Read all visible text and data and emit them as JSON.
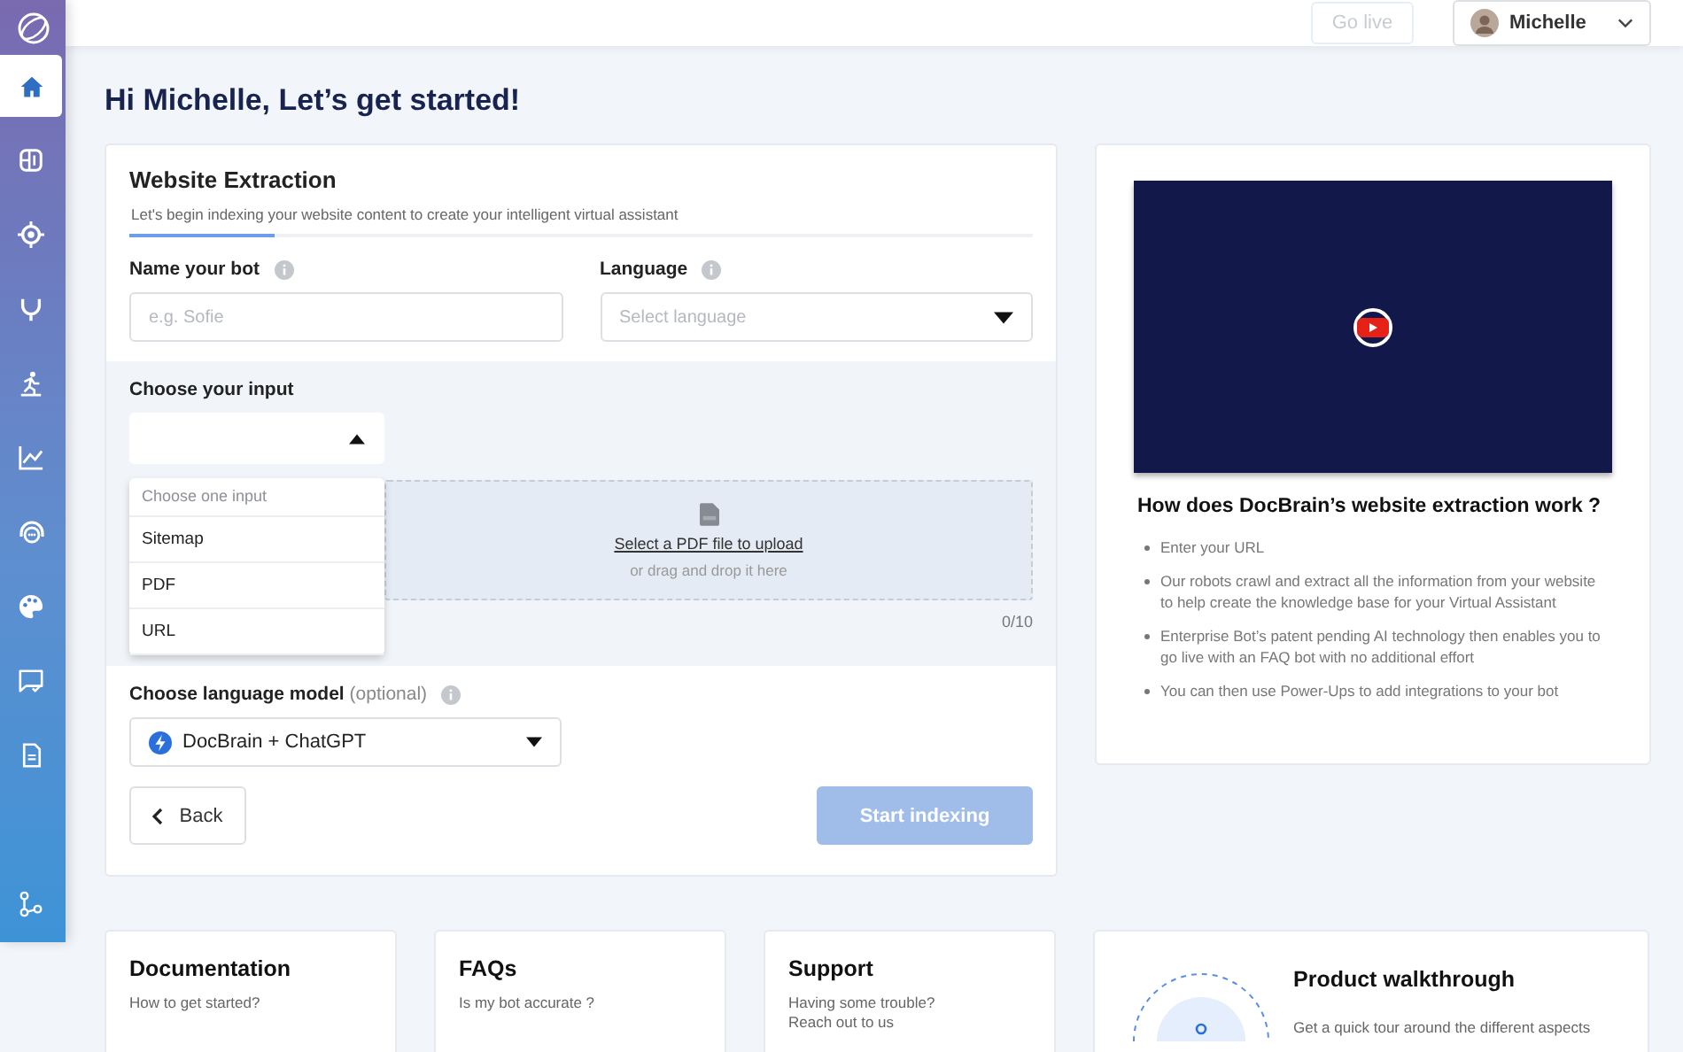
{
  "sidebar": {
    "items": [
      {
        "selected": true
      },
      {
        "selected": false
      },
      {
        "selected": false
      },
      {
        "selected": false
      },
      {
        "selected": false
      },
      {
        "selected": false
      },
      {
        "selected": false
      },
      {
        "selected": false
      },
      {
        "selected": false
      },
      {
        "selected": false
      },
      {
        "selected": false
      }
    ]
  },
  "topbar": {
    "go_live": {
      "label": "Go live",
      "disabled": true
    },
    "user": {
      "name": "Michelle"
    }
  },
  "heading": "Hi Michelle, Let’s get started!",
  "extraction": {
    "title": "Website Extraction",
    "subtitle": "Let's begin indexing your website content to create your intelligent virtual assistant",
    "progress": {
      "level": 0.16
    },
    "name_field": {
      "label": "Name your bot",
      "placeholder": "e.g. Sofie"
    },
    "language_field": {
      "label": "Language",
      "placeholder": "Select language"
    },
    "input": {
      "label": "Choose your input",
      "expanded": true,
      "menu_header": "Choose one input",
      "options": [
        "Sitemap",
        "PDF",
        "URL"
      ]
    },
    "upload": {
      "link": "Select a PDF file to upload",
      "hint": "or drag and drop it here",
      "count": "0/10"
    },
    "model": {
      "label": "Choose language model",
      "note": "(optional)",
      "value": "DocBrain + ChatGPT"
    },
    "back": "Back",
    "start": {
      "label": "Start indexing",
      "disabled": true
    }
  },
  "video_card": {
    "title": "How does DocBrain’s website extraction work ?",
    "bullets": [
      "Enter your URL",
      "Our robots crawl and extract all the information from your website to help create the knowledge base for your Virtual Assistant",
      "Enterprise Bot’s patent pending AI technology then enables you to go live with an FAQ bot with no additional effort",
      "You can then use Power-Ups to add integrations to your bot"
    ]
  },
  "resources": [
    {
      "title": "Documentation",
      "lines": [
        "How to get started?"
      ]
    },
    {
      "title": "FAQs",
      "lines": [
        "Is my bot accurate ?"
      ]
    },
    {
      "title": "Support",
      "lines": [
        "Having some trouble?",
        "Reach out to us"
      ]
    }
  ],
  "walkthrough": {
    "title": "Product walkthrough",
    "text": "Get a quick tour around the different aspects"
  }
}
